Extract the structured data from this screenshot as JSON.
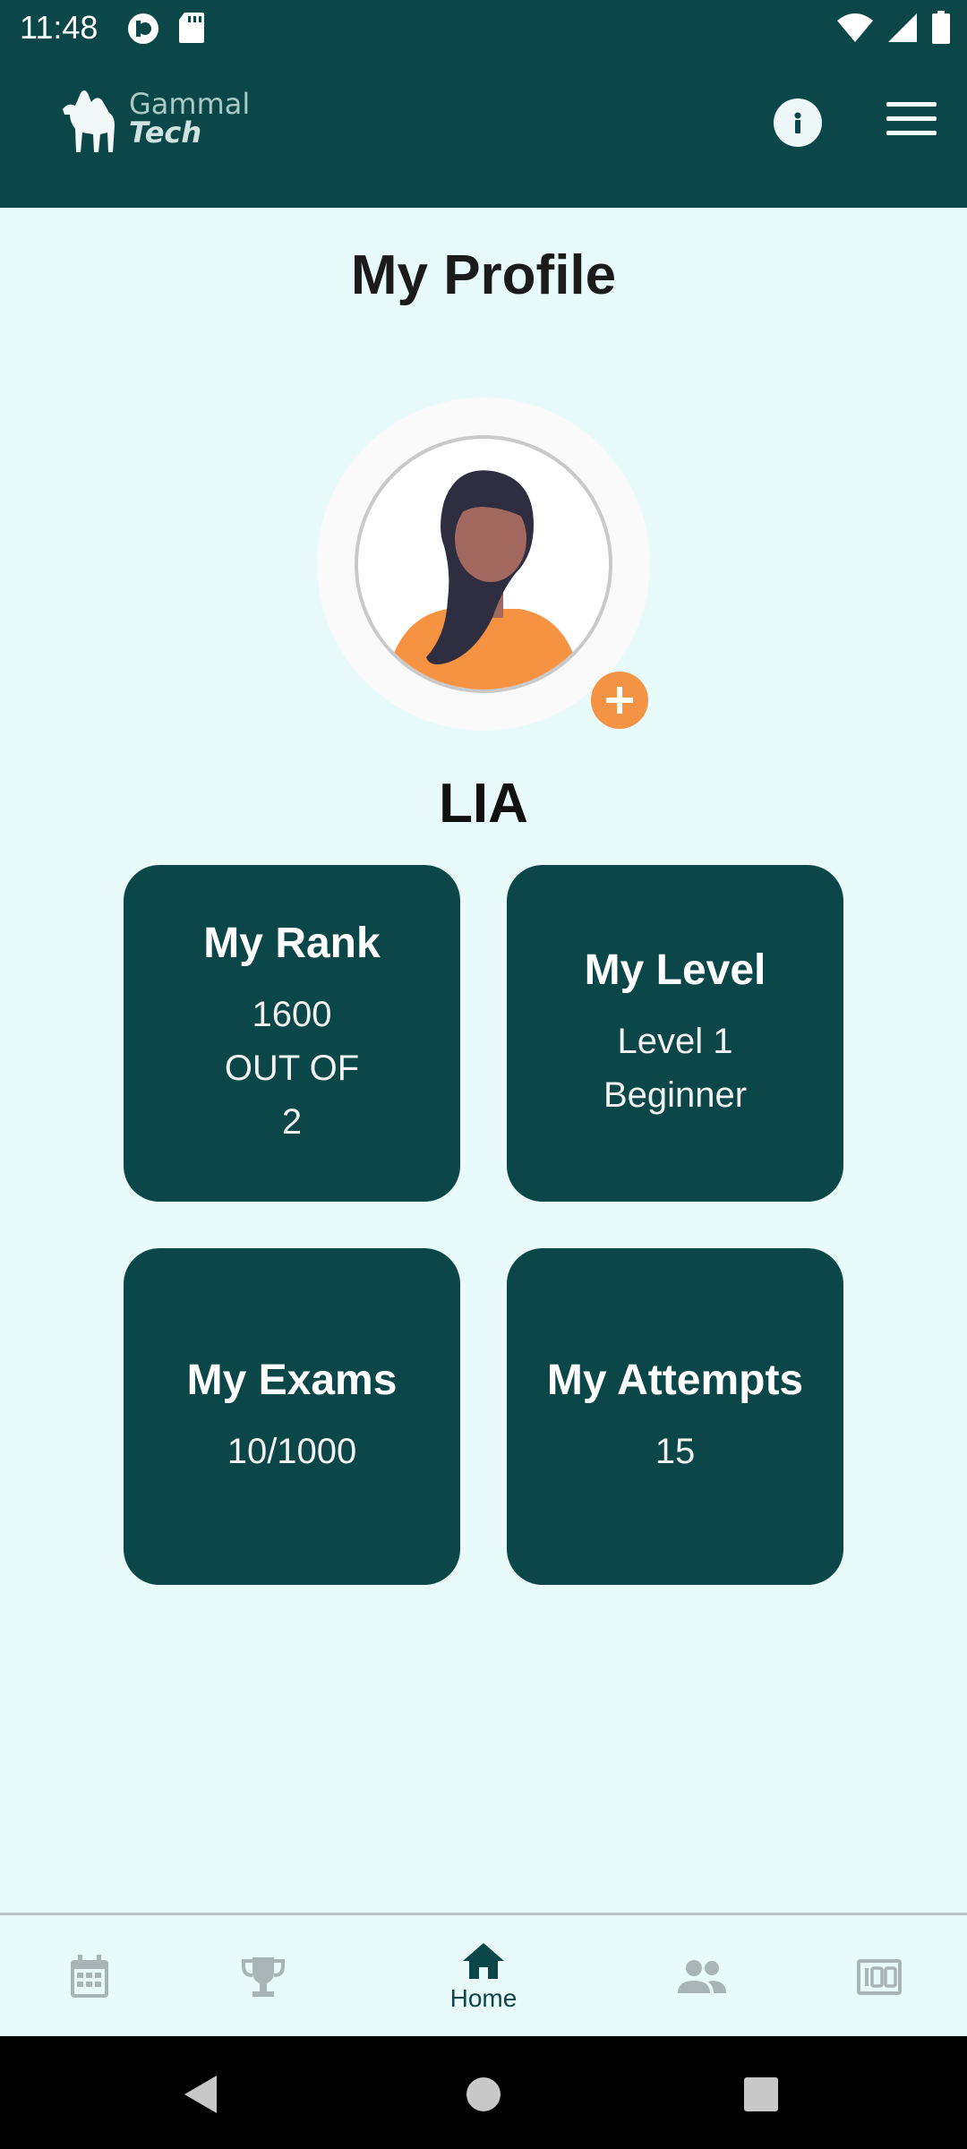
{
  "status_bar": {
    "time": "11:48",
    "left_icons": [
      "pocket-casts-icon",
      "sd-card-icon"
    ],
    "right_icons": [
      "wifi-icon",
      "cell-signal-icon",
      "battery-icon"
    ]
  },
  "app_bar": {
    "logo_line1": "Gammal",
    "logo_line2": "Tech",
    "info_icon": "info-icon",
    "menu_icon": "hamburger-menu-icon"
  },
  "profile": {
    "title": "My Profile",
    "name": "LIA"
  },
  "cards": {
    "rank": {
      "title": "My Rank",
      "value": "1600",
      "out_of": "OUT OF",
      "total": "2"
    },
    "level": {
      "title": "My Level",
      "level": "Level 1",
      "label": "Beginner"
    },
    "exams": {
      "title": "My Exams",
      "value": "10/1000"
    },
    "attempts": {
      "title": "My Attempts",
      "value": "15"
    }
  },
  "bottom_nav": {
    "items": [
      {
        "icon": "calendar-icon",
        "label": ""
      },
      {
        "icon": "trophy-icon",
        "label": ""
      },
      {
        "icon": "home-icon",
        "label": "Home",
        "active": true
      },
      {
        "icon": "people-icon",
        "label": ""
      },
      {
        "icon": "score-100-icon",
        "label": ""
      }
    ]
  },
  "colors": {
    "primary": "#0b4648",
    "background": "#e9fafa",
    "accent": "#f59345",
    "inactive_icon": "#a8b5b8"
  }
}
